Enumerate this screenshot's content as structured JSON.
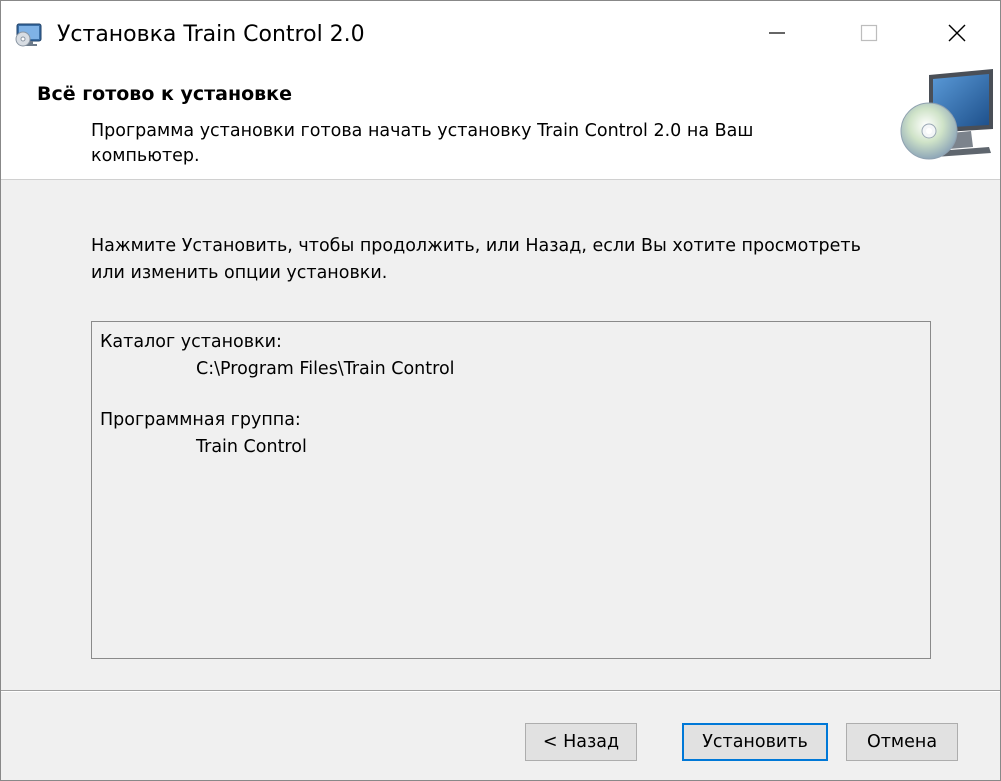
{
  "window": {
    "title": "Установка Train Control 2.0",
    "controls": {
      "minimize": "minimize-icon",
      "maximize": "maximize-icon",
      "close": "close-icon"
    }
  },
  "header": {
    "title": "Всё готово к установке",
    "description": "Программа установки готова начать установку Train Control 2.0 на Ваш компьютер.",
    "art_icon": "install-cd-icon"
  },
  "content": {
    "instruction": "Нажмите Установить, чтобы продолжить, или Назад, если Вы хотите просмотреть или изменить опции установки.",
    "summary": {
      "install_dir_label": "Каталог установки:",
      "install_dir_value": "C:\\Program Files\\Train Control",
      "program_group_label": "Программная группа:",
      "program_group_value": "Train Control"
    }
  },
  "buttons": {
    "back": "< Назад",
    "install": "Установить",
    "cancel": "Отмена"
  },
  "colors": {
    "accent": "#0078d7",
    "window_bg": "#f0f0f0",
    "header_bg": "#ffffff"
  }
}
